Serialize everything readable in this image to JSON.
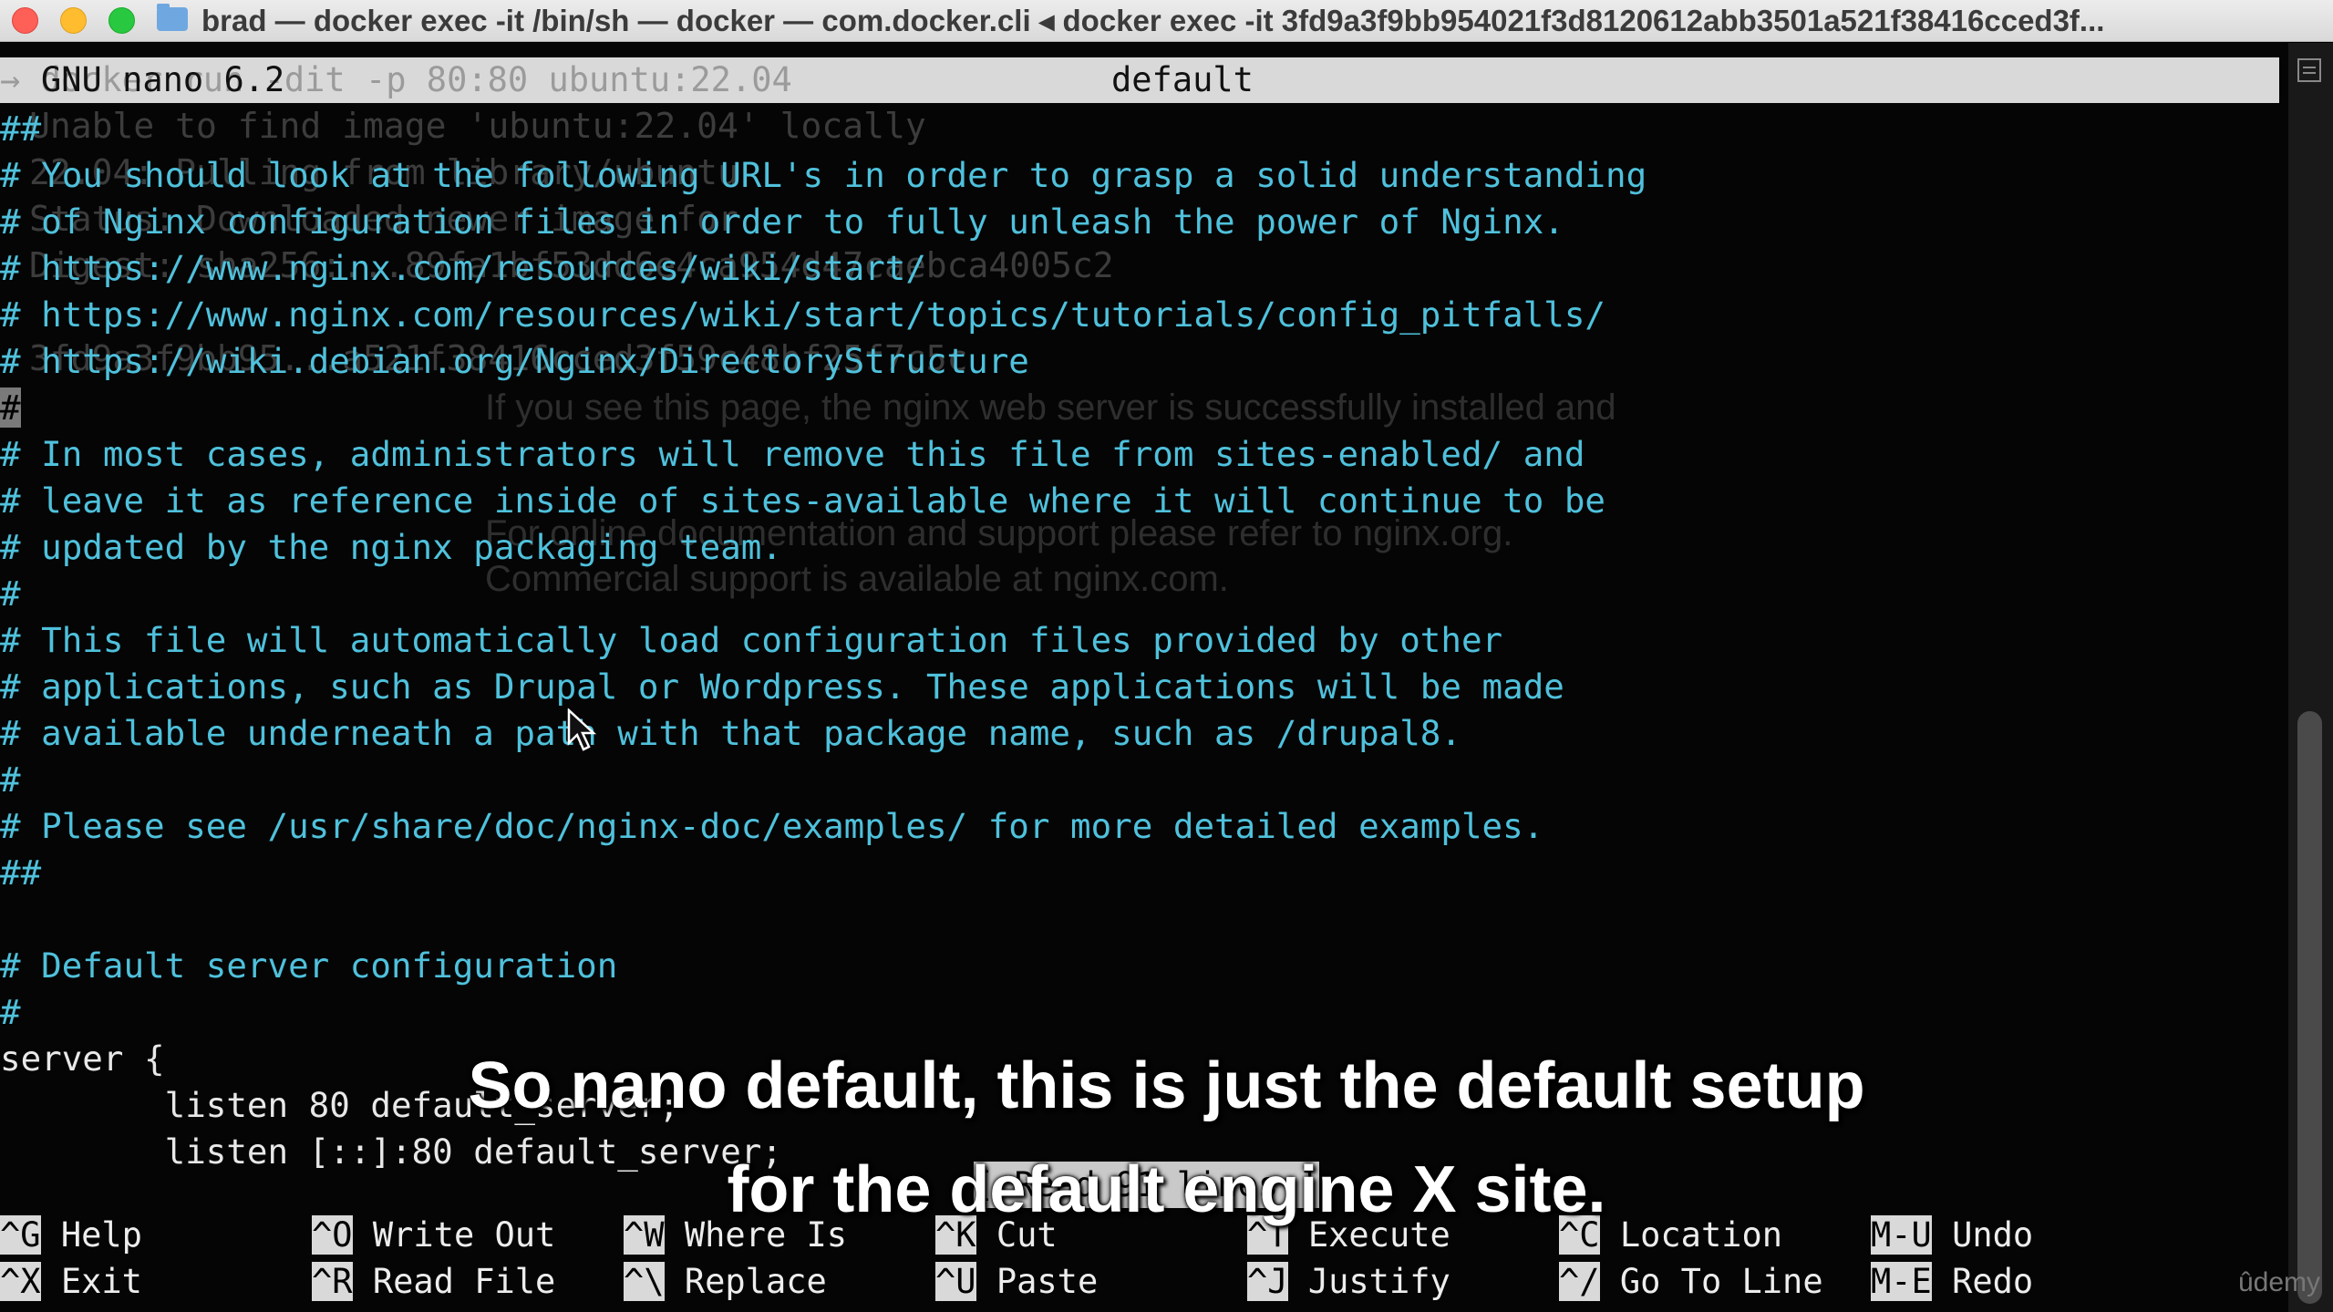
{
  "window": {
    "title": "brad — docker exec -it  /bin/sh — docker — com.docker.cli ◂ docker exec -it 3fd9a3f9bb954021f3d8120612abb3501a521f38416cced3f..."
  },
  "nano": {
    "version": "GNU nano 6.2",
    "filename": "default",
    "ghost_command": "→ docker run -dit -p 80:80 ubuntu:22.04"
  },
  "background_ghost": {
    "line1": "Unable to find image 'ubuntu:22.04' locally",
    "line2": "22.04: Pulling from library/ubuntu",
    "line3": "Status: Downloaded newer image for",
    "line4": "Digest: sha256:...89fa1bf53dd6e4ca954d47caebca4005c2",
    "line5": "3fd9a3f9bb95...a521f38416cced3f59c48bf25f7c5c",
    "web1": "If you see this page, the nginx web server is successfully installed and",
    "web2": "For online documentation and support please refer to nginx.org.",
    "web3": "Commercial support is available at nginx.com."
  },
  "editor": {
    "lines": [
      "##",
      "# You should look at the following URL's in order to grasp a solid understanding",
      "# of Nginx configuration files in order to fully unleash the power of Nginx.",
      "# https://www.nginx.com/resources/wiki/start/",
      "# https://www.nginx.com/resources/wiki/start/topics/tutorials/config_pitfalls/",
      "# https://wiki.debian.org/Nginx/DirectoryStructure",
      "#",
      "# In most cases, administrators will remove this file from sites-enabled/ and",
      "# leave it as reference inside of sites-available where it will continue to be",
      "# updated by the nginx packaging team.",
      "#",
      "# This file will automatically load configuration files provided by other",
      "# applications, such as Drupal or Wordpress. These applications will be made",
      "# available underneath a path with that package name, such as /drupal8.",
      "#",
      "# Please see /usr/share/doc/nginx-doc/examples/ for more detailed examples.",
      "##",
      "",
      "# Default server configuration",
      "#",
      "server {",
      "        listen 80 default_server;",
      "        listen [::]:80 default_server;"
    ],
    "status_message": "[ Read 91 lines ]"
  },
  "shortcuts": [
    {
      "key": "^G",
      "label": "Help"
    },
    {
      "key": "^O",
      "label": "Write Out"
    },
    {
      "key": "^W",
      "label": "Where Is"
    },
    {
      "key": "^K",
      "label": "Cut"
    },
    {
      "key": "^T",
      "label": "Execute"
    },
    {
      "key": "^C",
      "label": "Location"
    },
    {
      "key": "M-U",
      "label": "Undo"
    },
    {
      "key": "^X",
      "label": "Exit"
    },
    {
      "key": "^R",
      "label": "Read File"
    },
    {
      "key": "^\\",
      "label": "Replace"
    },
    {
      "key": "^U",
      "label": "Paste"
    },
    {
      "key": "^J",
      "label": "Justify"
    },
    {
      "key": "^/",
      "label": "Go To Line"
    },
    {
      "key": "M-E",
      "label": "Redo"
    }
  ],
  "subtitles": {
    "line1": "So nano default, this is just the default setup",
    "line2": "for the default engine X site."
  },
  "watermark": "ûdemy",
  "colors": {
    "comment": "#4fc1dc",
    "code": "#e8e8e8",
    "header_bg": "#d9d9d9",
    "terminal_bg": "#050505"
  }
}
